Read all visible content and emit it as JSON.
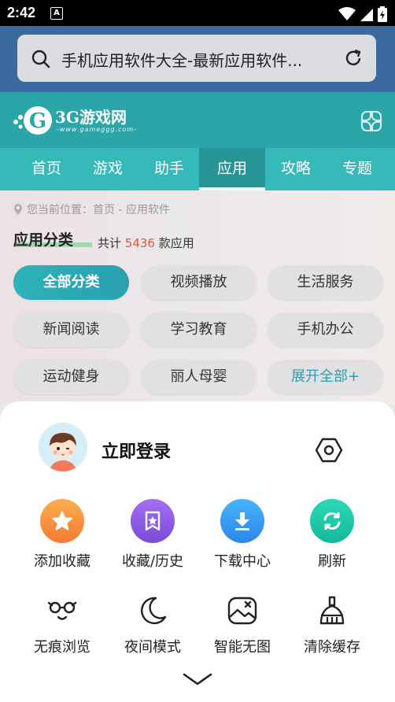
{
  "status_bar": {
    "time": "2:42",
    "notif_icon": "A"
  },
  "search": {
    "text": "手机应用软件大全-最新应用软件..."
  },
  "site": {
    "logo_text": "3G游戏网",
    "logo_sub": "-www.gameggg.com-"
  },
  "nav": {
    "items": [
      "首页",
      "游戏",
      "助手",
      "应用",
      "攻略",
      "专题"
    ],
    "active_index": 3
  },
  "breadcrumb": "您当前位置：首页 - 应用软件",
  "category": {
    "title": "应用分类",
    "count_prefix": "共计",
    "count": "5436",
    "count_suffix": "款应用"
  },
  "chips": [
    "全部分类",
    "视频播放",
    "生活服务",
    "新闻阅读",
    "学习教育",
    "手机办公",
    "运动健身",
    "丽人母婴",
    "展开全部+"
  ],
  "sheet": {
    "login": "立即登录",
    "actions": [
      "添加收藏",
      "收藏/历史",
      "下载中心",
      "刷新"
    ],
    "tools": [
      "无痕浏览",
      "夜间模式",
      "智能无图",
      "清除缓存"
    ]
  },
  "colors": {
    "teal": "#2aa6a8",
    "star_orange": "#f58a3a",
    "purple": "#8a5ae0",
    "blue": "#2a90ee",
    "green": "#1dc9a8",
    "count_red": "#e05a3a"
  }
}
